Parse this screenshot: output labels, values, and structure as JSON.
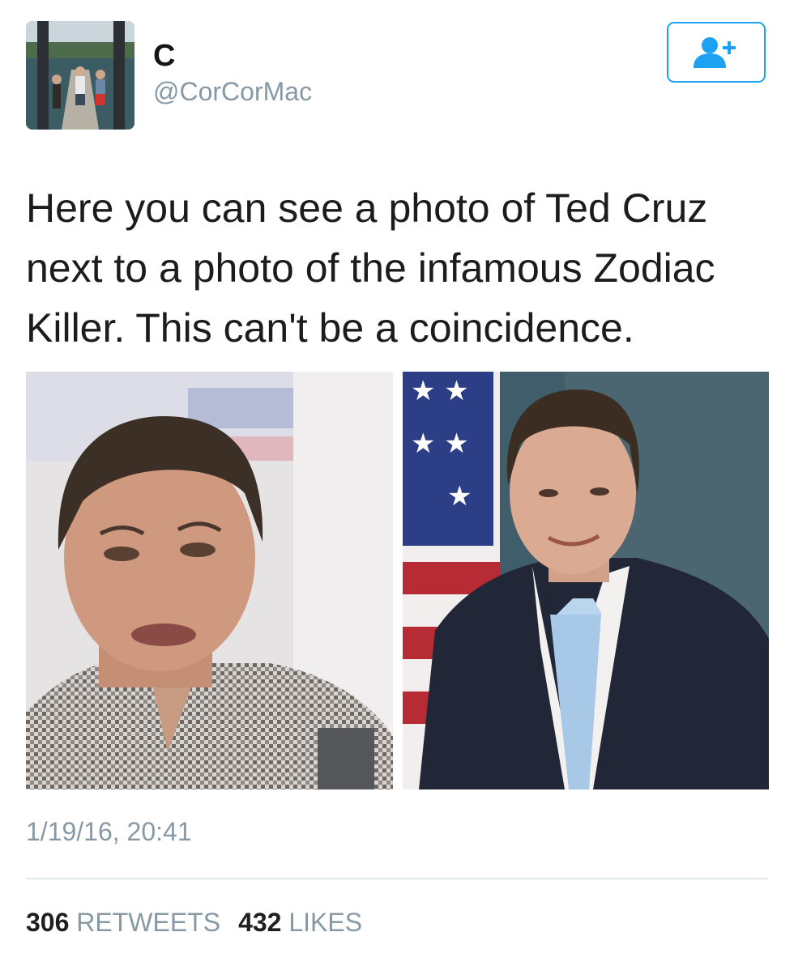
{
  "user": {
    "display_name": "C",
    "handle": "@CorCorMac"
  },
  "follow_button": {
    "icon": "add-user-icon",
    "color": "#1da1f2"
  },
  "tweet": {
    "text": "Here you can see a photo of Ted Cruz next to a photo of the infamous Zodiac Killer. This can't be a coincidence.",
    "timestamp": "1/19/16, 20:41"
  },
  "stats": {
    "retweets_count": "306",
    "retweets_label": "RETWEETS",
    "likes_count": "432",
    "likes_label": "LIKES"
  },
  "colors": {
    "accent": "#1da1f2",
    "muted_text": "#8899a6",
    "divider": "#e1e8ed"
  }
}
